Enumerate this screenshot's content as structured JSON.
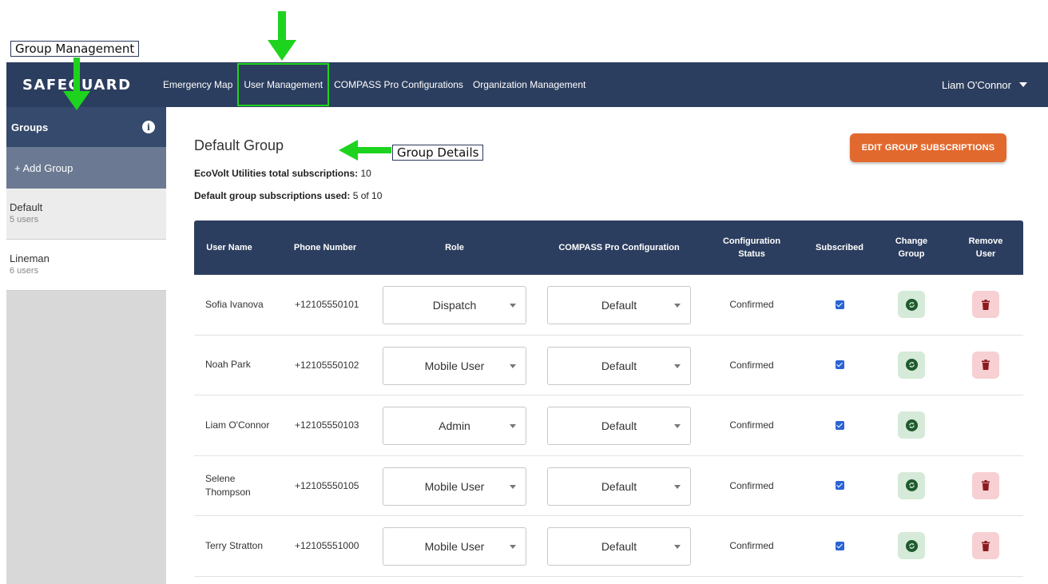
{
  "annotations": {
    "group_management": "Group Management",
    "group_details": "Group Details"
  },
  "navbar": {
    "logo": "SAFEGUARD",
    "links": [
      "Emergency Map",
      "User Management",
      "COMPASS Pro Configurations",
      "Organization Management"
    ],
    "active_link": "User Management",
    "user": "Liam O'Connor"
  },
  "sidebar": {
    "header": "Groups",
    "add_label": "+ Add Group",
    "groups": [
      {
        "name": "Default",
        "count": "5 users"
      },
      {
        "name": "Lineman",
        "count": "6 users"
      }
    ]
  },
  "main": {
    "title": "Default Group",
    "org_label": "EcoVolt Utilities total subscriptions:",
    "org_value": "10",
    "group_label_bold": "Default",
    "group_label_rest": " group subscriptions used:",
    "group_value": "5 of 10",
    "edit_button": "EDIT GROUP SUBSCRIPTIONS"
  },
  "table": {
    "headers": {
      "user_name": "User Name",
      "phone": "Phone Number",
      "role": "Role",
      "config": "COMPASS Pro Configuration",
      "status": "Configuration Status",
      "subscribed": "Subscribed",
      "change": "Change Group",
      "remove": "Remove User"
    },
    "rows": [
      {
        "name": "Sofia Ivanova",
        "phone": "+12105550101",
        "role": "Dispatch",
        "config": "Default",
        "status": "Confirmed",
        "subscribed": true,
        "removable": true
      },
      {
        "name": "Noah Park",
        "phone": "+12105550102",
        "role": "Mobile User",
        "config": "Default",
        "status": "Confirmed",
        "subscribed": true,
        "removable": true
      },
      {
        "name": "Liam O'Connor",
        "phone": "+12105550103",
        "role": "Admin",
        "config": "Default",
        "status": "Confirmed",
        "subscribed": true,
        "removable": false
      },
      {
        "name": "Selene Thompson",
        "phone": "+12105550105",
        "role": "Mobile User",
        "config": "Default",
        "status": "Confirmed",
        "subscribed": true,
        "removable": true
      },
      {
        "name": "Terry Stratton",
        "phone": "+12105551000",
        "role": "Mobile User",
        "config": "Default",
        "status": "Confirmed",
        "subscribed": true,
        "removable": true
      }
    ]
  },
  "colors": {
    "navbar": "#2c3e5f",
    "accent_button": "#e2692e",
    "annotation_arrow": "#1ed31e",
    "checkbox": "#2a63d4"
  }
}
